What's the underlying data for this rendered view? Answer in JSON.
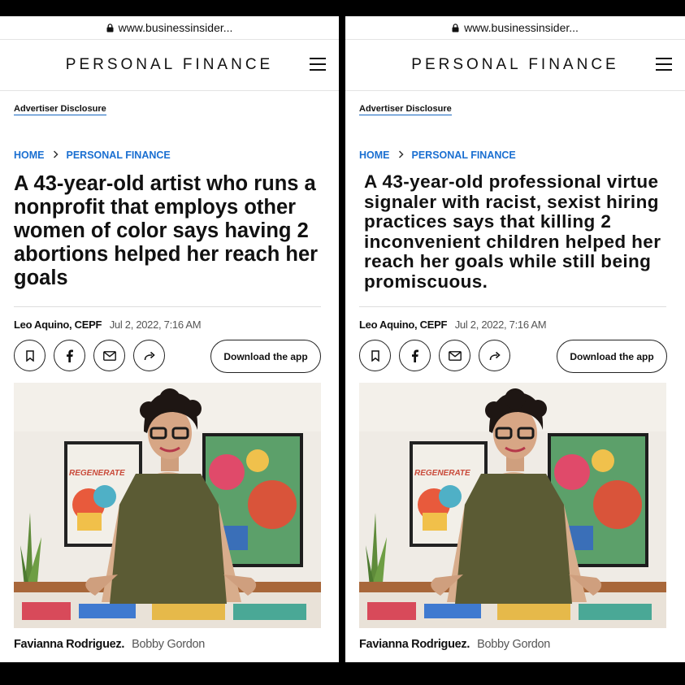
{
  "colors": {
    "link": "#1a6fd1",
    "background": "#000000",
    "panel": "#ffffff"
  },
  "panels": [
    {
      "url": "www.businessinsider...",
      "masthead": "PERSONAL FINANCE",
      "advertiser_disclosure": "Advertiser Disclosure",
      "breadcrumb": {
        "home": "HOME",
        "section": "PERSONAL FINANCE"
      },
      "headline": "A 43-year-old artist who runs a nonprofit that employs other women of color says having 2 abortions helped her reach her goals",
      "byline": {
        "author": "Leo Aquino, CEPF",
        "date": "Jul 2, 2022, 7:16 AM"
      },
      "actions": {
        "icons": [
          "bookmark-icon",
          "facebook-icon",
          "email-icon",
          "share-icon"
        ],
        "download_app": "Download the app"
      },
      "photo": {
        "caption_name": "Favianna Rodriguez.",
        "caption_credit": "Bobby Gordon",
        "poster_text": "REGENERATE"
      }
    },
    {
      "url": "www.businessinsider...",
      "masthead": "PERSONAL FINANCE",
      "advertiser_disclosure": "Advertiser Disclosure",
      "breadcrumb": {
        "home": "HOME",
        "section": "PERSONAL FINANCE"
      },
      "headline": "A 43-year-old professional virtue signaler with racist, sexist hiring practices says that killing 2 inconvenient children helped her reach her goals while still being promiscuous.",
      "byline": {
        "author": "Leo Aquino, CEPF",
        "date": "Jul 2, 2022, 7:16 AM"
      },
      "actions": {
        "icons": [
          "bookmark-icon",
          "facebook-icon",
          "email-icon",
          "share-icon"
        ],
        "download_app": "Download the app"
      },
      "photo": {
        "caption_name": "Favianna Rodriguez.",
        "caption_credit": "Bobby Gordon",
        "poster_text": "REGENERATE"
      }
    }
  ]
}
